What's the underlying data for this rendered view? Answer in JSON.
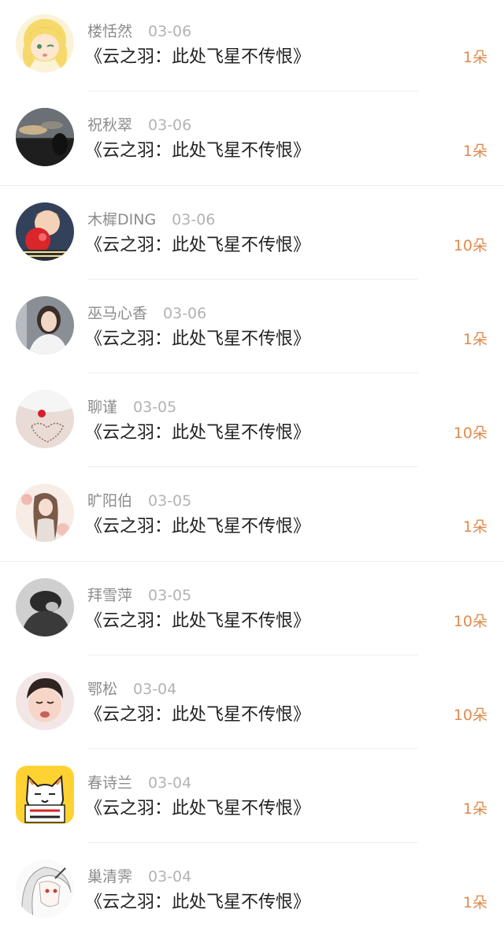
{
  "colors": {
    "username": "#8c8c8c",
    "date": "#b3b3b3",
    "title": "#222222",
    "amount": "#e08a4c"
  },
  "gifts": [
    {
      "user": "楼恬然",
      "date": "03-06",
      "title": "《云之羽：此处飞星不传恨》",
      "amount": "1朵",
      "avatar_icon": "anime-girl-avatar"
    },
    {
      "user": "祝秋翠",
      "date": "03-06",
      "title": "《云之羽：此处飞星不传恨》",
      "amount": "1朵",
      "avatar_icon": "sunset-landscape-avatar"
    },
    {
      "user": "木樨DING",
      "date": "03-06",
      "title": "《云之羽：此处飞星不传恨》",
      "amount": "10朵",
      "avatar_icon": "baby-photo-avatar"
    },
    {
      "user": "巫马心香",
      "date": "03-06",
      "title": "《云之羽：此处飞星不传恨》",
      "amount": "1朵",
      "avatar_icon": "girl-photo-avatar"
    },
    {
      "user": "聊谨",
      "date": "03-05",
      "title": "《云之羽：此处飞星不传恨》",
      "amount": "10朵",
      "avatar_icon": "beach-heart-avatar"
    },
    {
      "user": "旷阳伯",
      "date": "03-05",
      "title": "《云之羽：此处飞星不传恨》",
      "amount": "1朵",
      "avatar_icon": "illustrated-girl-avatar"
    },
    {
      "user": "拜雪萍",
      "date": "03-05",
      "title": "《云之羽：此处飞星不传恨》",
      "amount": "10朵",
      "avatar_icon": "grayscale-photo-avatar"
    },
    {
      "user": "鄂松",
      "date": "03-04",
      "title": "《云之羽：此处飞星不传恨》",
      "amount": "10朵",
      "avatar_icon": "crying-child-avatar"
    },
    {
      "user": "春诗兰",
      "date": "03-04",
      "title": "《云之羽：此处飞星不传恨》",
      "amount": "1朵",
      "avatar_icon": "cat-sticker-avatar",
      "avatar_text": "不瘦十斤不换头像"
    },
    {
      "user": "巢清霁",
      "date": "03-04",
      "title": "《云之羽：此处飞星不传恨》",
      "amount": "1朵",
      "avatar_icon": "anime-character-avatar"
    }
  ]
}
